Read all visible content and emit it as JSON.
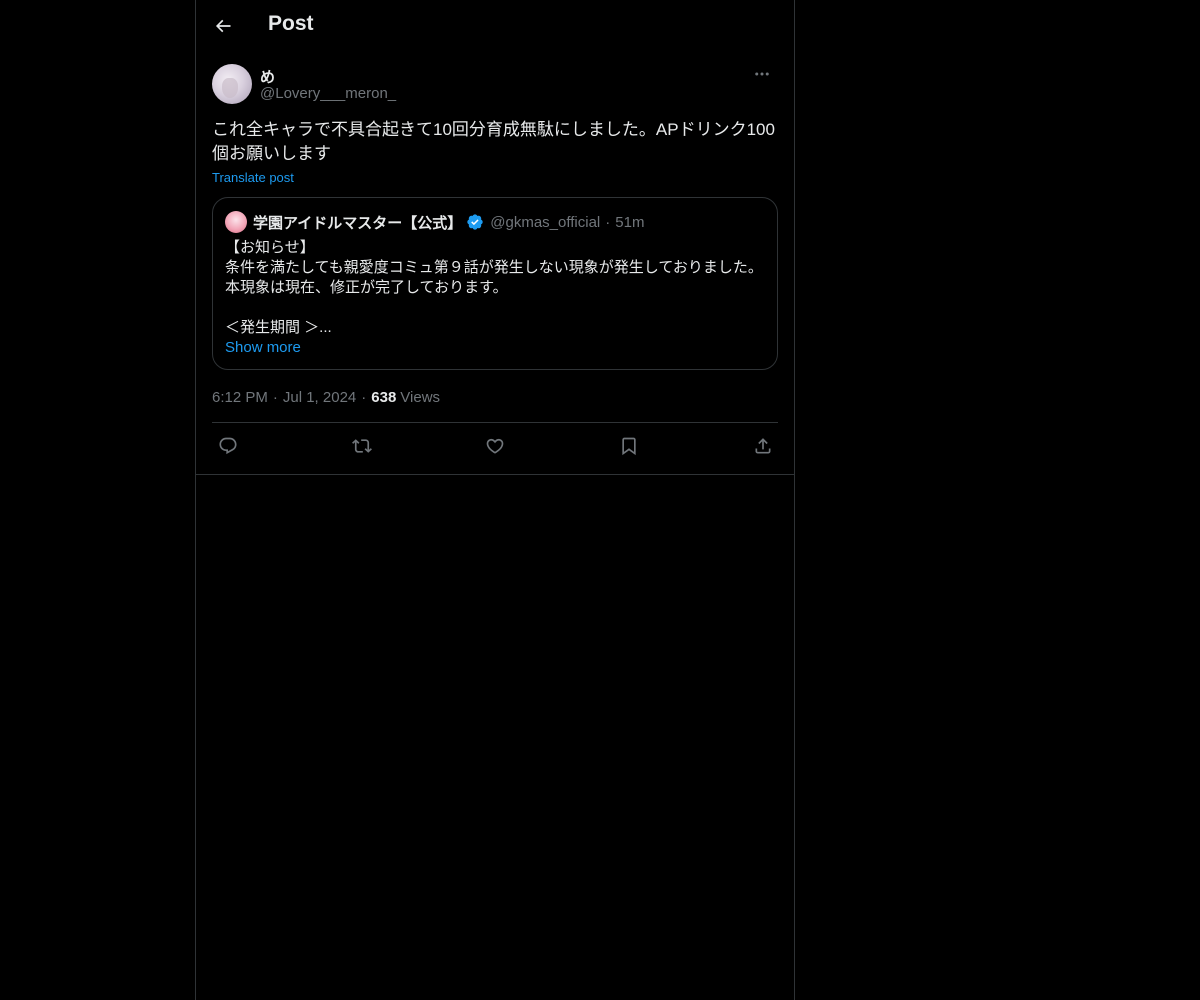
{
  "header": {
    "back_icon": "arrow-left-icon",
    "title": "Post"
  },
  "post": {
    "author": {
      "name": "め",
      "handle": "@Lovery___meron_"
    },
    "more_icon": "more-horizontal-icon",
    "text": "これ全キャラで不具合起きて10回分育成無駄にしました。APドリンク100個お願いします",
    "translate_label": "Translate post",
    "quote": {
      "name": "学園アイドルマスター【公式】",
      "verified_icon": "verified-badge-icon",
      "handle": "@gkmas_official",
      "separator": "·",
      "time": "51m",
      "lines": [
        "【お知らせ】",
        "条件を満たしても親愛度コミュ第９話が発生しない現象が発生しておりました。",
        "本現象は現在、修正が完了しております。",
        "",
        "＜発生期間 ＞..."
      ],
      "show_more": "Show more"
    },
    "meta": {
      "time": "6:12 PM",
      "separator": "·",
      "date": "Jul 1, 2024",
      "views_count": "638",
      "views_label": "Views"
    },
    "actions": [
      {
        "icon": "reply-icon"
      },
      {
        "icon": "repost-icon"
      },
      {
        "icon": "like-icon"
      },
      {
        "icon": "bookmark-icon"
      },
      {
        "icon": "share-icon"
      }
    ]
  },
  "colors": {
    "background": "#000000",
    "text": "#e7e9ea",
    "secondary": "#71767b",
    "accent": "#1d9bf0",
    "border": "#2f3336"
  }
}
